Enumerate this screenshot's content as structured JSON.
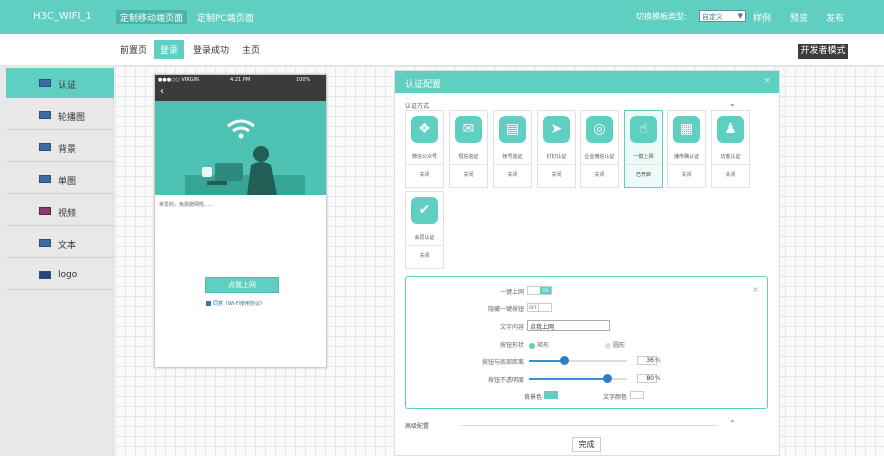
{
  "app": {
    "title": "H3C_WIFI_1"
  },
  "topnav": {
    "mobile": "定制移动端页面",
    "pc": "定制PC端页面"
  },
  "template_switch": {
    "label": "切换模板类型:",
    "value": "自定义"
  },
  "top_actions": {
    "sample": "样例",
    "preview": "预览",
    "publish": "发布"
  },
  "subtabs": [
    "前置页",
    "登录",
    "登录成功",
    "主页"
  ],
  "dev_mode": "开发者模式",
  "sidebar": {
    "items": [
      {
        "label": "认证",
        "icon": "auth-icon"
      },
      {
        "label": "轮播图",
        "icon": "carousel-icon"
      },
      {
        "label": "背景",
        "icon": "background-icon"
      },
      {
        "label": "单图",
        "icon": "single-image-icon"
      },
      {
        "label": "视频",
        "icon": "video-icon"
      },
      {
        "label": "文本",
        "icon": "text-icon"
      },
      {
        "label": "logo",
        "icon": "logo-icon"
      }
    ]
  },
  "phone": {
    "carrier": "●●●○○ VIRGIN",
    "time": "4:21 PM",
    "battery": "100%",
    "caption": "亲爱的，免费蹭网啦……",
    "button": "点我上网",
    "agreement": "同意《Wi-Fi使用协议》"
  },
  "panel": {
    "title": "认证配置",
    "close": "×",
    "auth_method_label": "认证方式",
    "methods": [
      {
        "name": "微信公众号",
        "status": "关闭",
        "icon": "wechat-icon",
        "glyph": "❖"
      },
      {
        "name": "短信验证",
        "status": "关闭",
        "icon": "mail-icon",
        "glyph": "✉"
      },
      {
        "name": "帐号验证",
        "status": "关闭",
        "icon": "lock-icon",
        "glyph": "▤"
      },
      {
        "name": "钉钉认证",
        "status": "关闭",
        "icon": "dingtalk-icon",
        "glyph": "➤"
      },
      {
        "name": "企业微信认证",
        "status": "关闭",
        "icon": "work-wechat-icon",
        "glyph": "◎"
      },
      {
        "name": "一键上网",
        "status": "已开启",
        "icon": "tap-icon",
        "glyph": "☝"
      },
      {
        "name": "播传确认证",
        "status": "关闭",
        "icon": "printer-icon",
        "glyph": "▦"
      },
      {
        "name": "访客认证",
        "status": "关闭",
        "icon": "visitor-icon",
        "glyph": "♟"
      },
      {
        "name": "会员认证",
        "status": "关闭",
        "icon": "member-icon",
        "glyph": "✔"
      }
    ],
    "detail": {
      "close": "×",
      "one_click_label": "一键上网",
      "one_click_state": "ON",
      "hide_btn_label": "隐藏一键按钮",
      "hide_btn_state": "OFF",
      "text_label": "文字内容",
      "text_value": "点我上网",
      "shape_label": "按钮形状",
      "shape_rect": "矩形",
      "shape_round": "圆形",
      "distance_label": "按钮与底部距离",
      "distance_value": "36",
      "opacity_label": "按钮不透明度",
      "opacity_value": "80",
      "percent": "%",
      "bg_color_label": "背景色",
      "text_color_label": "文字颜色"
    },
    "advanced_label": "高级配置",
    "done": "完成"
  },
  "colors": {
    "accent": "#5fcfc1",
    "accent_dark": "#47b6a8",
    "toolbar_dark": "#3d3d3d",
    "slider": "#2f7ec2"
  }
}
